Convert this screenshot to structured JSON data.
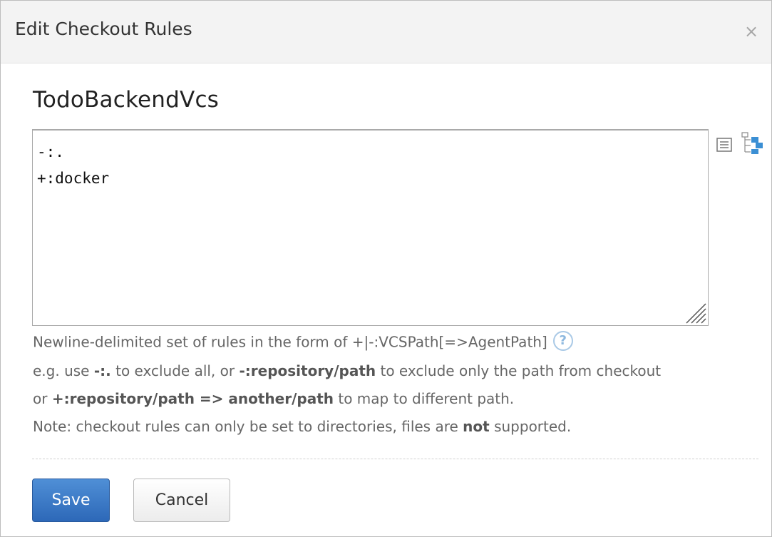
{
  "dialog": {
    "title": "Edit Checkout Rules",
    "close_glyph": "×"
  },
  "vcs_root": {
    "name": "TodoBackendVcs"
  },
  "rules": {
    "value": "-:.\n+:docker"
  },
  "toolbar": {
    "list_icon": "list-view-icon",
    "tree_icon": "vcs-tree-icon"
  },
  "hints": {
    "line1": "Newline-delimited set of rules in the form of +|-:VCSPath[=>AgentPath]",
    "line2_a": "e.g. use ",
    "line2_b": "-:.",
    "line2_c": " to exclude all, or ",
    "line2_d": "-:repository/path",
    "line2_e": " to exclude only the path from checkout",
    "line3_a": "or ",
    "line3_b": "+:repository/path => another/path",
    "line3_c": " to map to different path.",
    "line4_a": "Note: checkout rules can only be set to directories, files are ",
    "line4_b": "not",
    "line4_c": " supported.",
    "help_glyph": "?"
  },
  "buttons": {
    "save_label": "Save",
    "cancel_label": "Cancel"
  },
  "colors": {
    "primary": "#2d68b8",
    "header_bg": "#f3f3f3",
    "help_icon": "#8db8df"
  }
}
